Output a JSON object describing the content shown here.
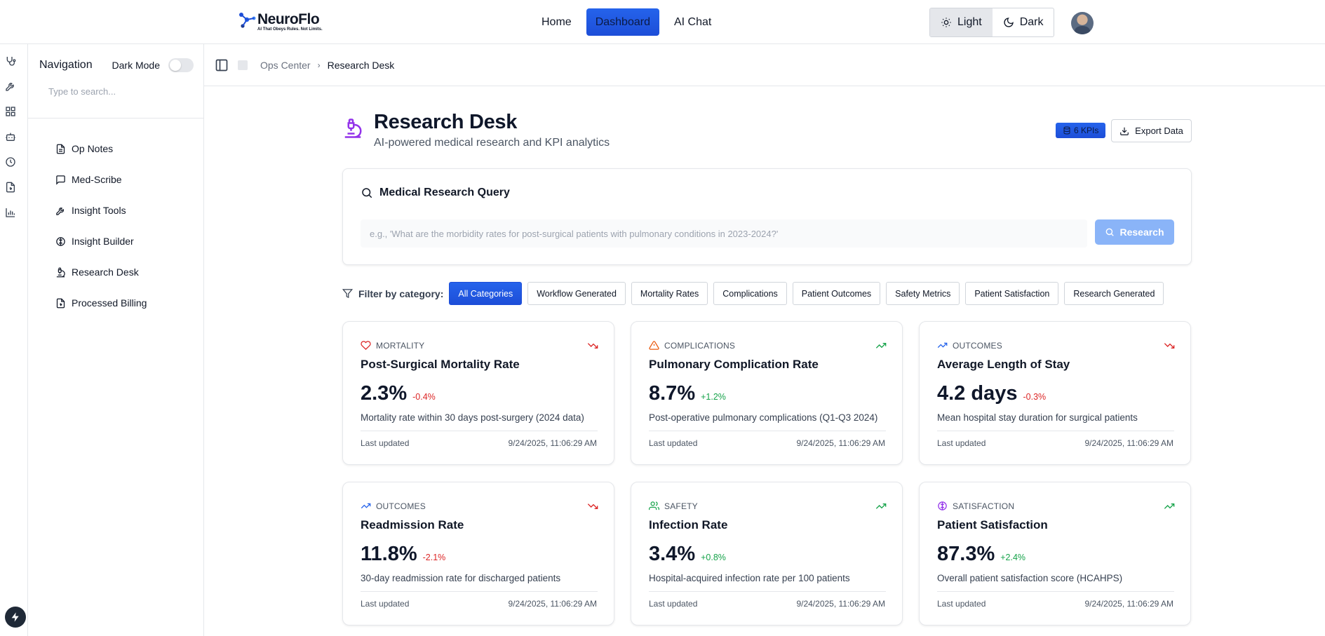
{
  "brand": {
    "name": "NeuroFlo",
    "tagline": "AI That Obeys Rules. Not Limits."
  },
  "topnav": [
    {
      "label": "Home",
      "active": false
    },
    {
      "label": "Dashboard",
      "active": true
    },
    {
      "label": "AI Chat",
      "active": false
    }
  ],
  "theme": {
    "light_label": "Light",
    "dark_label": "Dark",
    "selected": "Light"
  },
  "rail_icons": [
    "stethoscope-icon",
    "wrench-icon",
    "grid-icon",
    "bot-icon",
    "clock-icon",
    "file-dollar-icon",
    "bar-chart-icon"
  ],
  "sidebar": {
    "title": "Navigation",
    "dark_mode_label": "Dark Mode",
    "dark_mode_on": false,
    "search_placeholder": "Type to search...",
    "items": [
      {
        "label": "Op Notes",
        "icon": "document-icon"
      },
      {
        "label": "Med-Scribe",
        "icon": "message-icon"
      },
      {
        "label": "Insight Tools",
        "icon": "wrench-icon"
      },
      {
        "label": "Insight Builder",
        "icon": "brain-icon"
      },
      {
        "label": "Research Desk",
        "icon": "microscope-icon"
      },
      {
        "label": "Processed Billing",
        "icon": "file-dollar-icon"
      }
    ]
  },
  "breadcrumb": {
    "parent": "Ops Center",
    "current": "Research Desk"
  },
  "page": {
    "title": "Research Desk",
    "subtitle": "AI-powered medical research and KPI analytics",
    "kpi_badge": "6 KPIs",
    "export_label": "Export Data"
  },
  "query": {
    "heading": "Medical Research Query",
    "placeholder": "e.g., 'What are the morbidity rates for post-surgical patients with pulmonary conditions in 2023-2024?'",
    "button_label": "Research"
  },
  "filters": {
    "label": "Filter by category:",
    "chips": [
      "All Categories",
      "Workflow Generated",
      "Mortality Rates",
      "Complications",
      "Patient Outcomes",
      "Safety Metrics",
      "Patient Satisfaction",
      "Research Generated"
    ],
    "active": "All Categories"
  },
  "kpis": [
    {
      "category": "MORTALITY",
      "icon": "heart-icon",
      "icon_color": "#dc2626",
      "trend": "down",
      "title": "Post-Surgical Mortality Rate",
      "value": "2.3%",
      "change": "-0.4%",
      "description": "Mortality rate within 30 days post-surgery (2024 data)",
      "updated_label": "Last updated",
      "updated": "9/24/2025, 11:06:29 AM"
    },
    {
      "category": "COMPLICATIONS",
      "icon": "warning-icon",
      "icon_color": "#ea580c",
      "trend": "up",
      "title": "Pulmonary Complication Rate",
      "value": "8.7%",
      "change": "+1.2%",
      "description": "Post-operative pulmonary complications (Q1-Q3 2024)",
      "updated_label": "Last updated",
      "updated": "9/24/2025, 11:06:29 AM"
    },
    {
      "category": "OUTCOMES",
      "icon": "trending-up-icon",
      "icon_color": "#2563eb",
      "trend": "down",
      "title": "Average Length of Stay",
      "value": "4.2 days",
      "change": "-0.3%",
      "description": "Mean hospital stay duration for surgical patients",
      "updated_label": "Last updated",
      "updated": "9/24/2025, 11:06:29 AM"
    },
    {
      "category": "OUTCOMES",
      "icon": "trending-up-icon",
      "icon_color": "#2563eb",
      "trend": "down",
      "title": "Readmission Rate",
      "value": "11.8%",
      "change": "-2.1%",
      "description": "30-day readmission rate for discharged patients",
      "updated_label": "Last updated",
      "updated": "9/24/2025, 11:06:29 AM"
    },
    {
      "category": "SAFETY",
      "icon": "users-icon",
      "icon_color": "#16a34a",
      "trend": "up",
      "title": "Infection Rate",
      "value": "3.4%",
      "change": "+0.8%",
      "description": "Hospital-acquired infection rate per 100 patients",
      "updated_label": "Last updated",
      "updated": "9/24/2025, 11:06:29 AM"
    },
    {
      "category": "SATISFACTION",
      "icon": "brain-icon",
      "icon_color": "#9333ea",
      "trend": "up",
      "title": "Patient Satisfaction",
      "value": "87.3%",
      "change": "+2.4%",
      "description": "Overall patient satisfaction score (HCAHPS)",
      "updated_label": "Last updated",
      "updated": "9/24/2025, 11:06:29 AM"
    }
  ],
  "colors": {
    "accent": "#1d4ed8",
    "negative": "#dc2626",
    "positive": "#16a34a",
    "purple": "#9333ea"
  }
}
